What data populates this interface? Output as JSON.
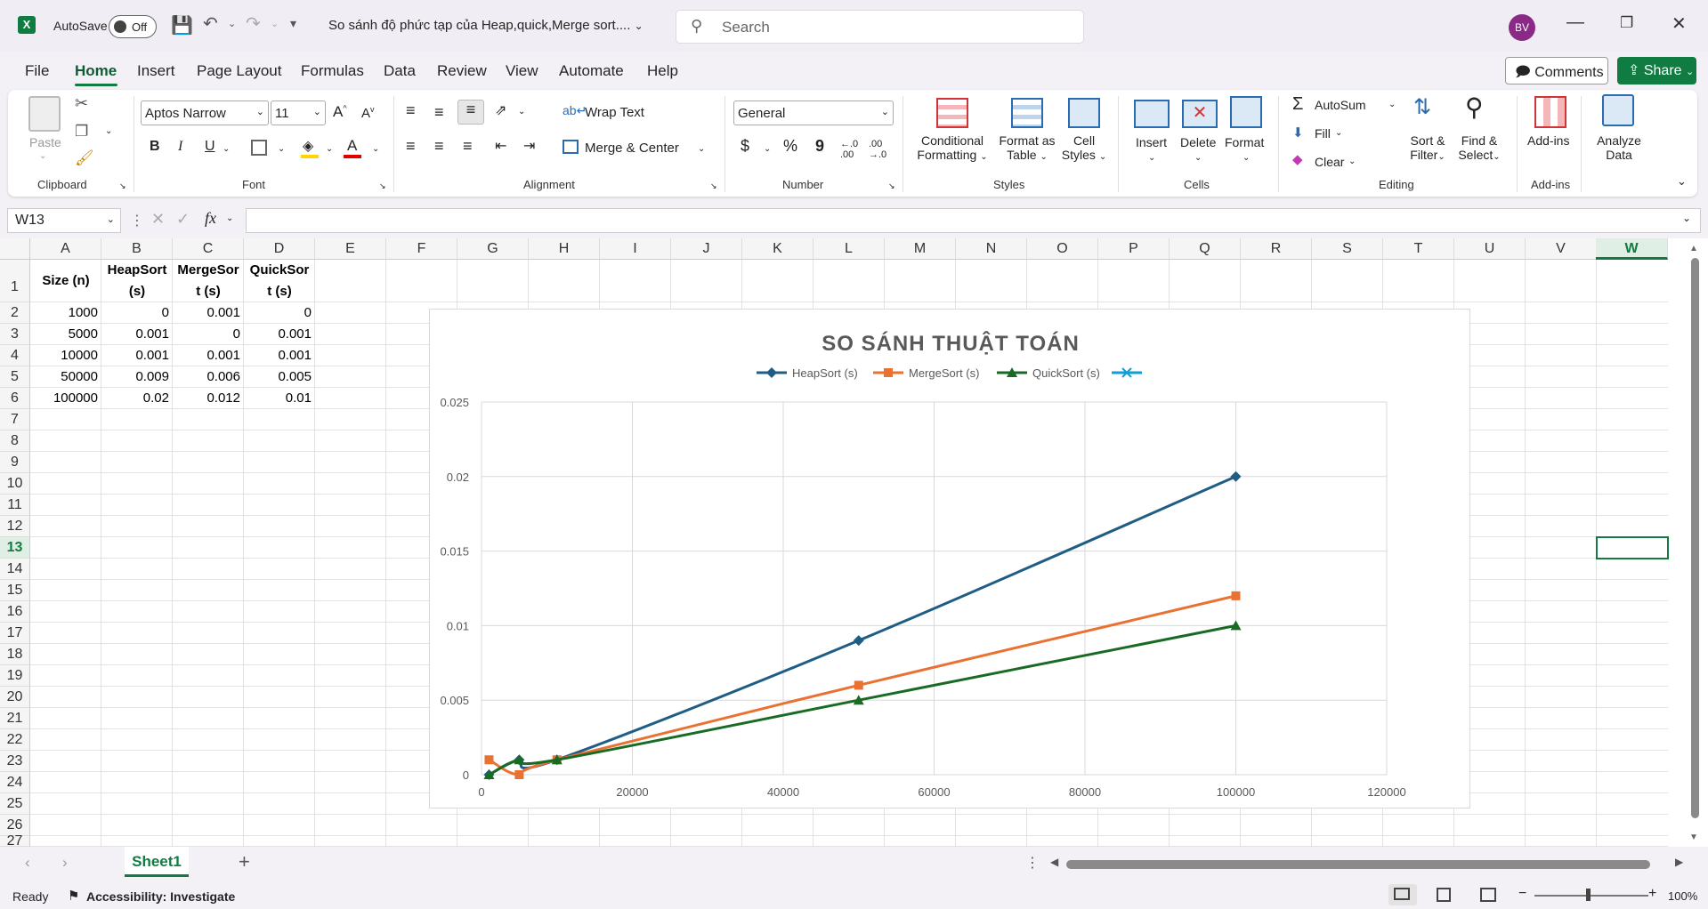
{
  "titlebar": {
    "autosave_label": "AutoSave",
    "autosave_state": "Off",
    "document_title": "So sánh độ phức tạp của Heap,quick,Merge sort....",
    "search_placeholder": "Search",
    "avatar_initials": "BV"
  },
  "menu": {
    "tabs": [
      "File",
      "Home",
      "Insert",
      "Page Layout",
      "Formulas",
      "Data",
      "Review",
      "View",
      "Automate",
      "Help"
    ],
    "active": "Home",
    "comments_label": "Comments",
    "share_label": "Share"
  },
  "ribbon": {
    "clipboard": {
      "paste": "Paste",
      "label": "Clipboard"
    },
    "font": {
      "name": "Aptos Narrow",
      "size": "11",
      "bold": "B",
      "italic": "I",
      "underline": "U",
      "label": "Font"
    },
    "alignment": {
      "wrap_text": "Wrap Text",
      "merge_center": "Merge & Center",
      "label": "Alignment"
    },
    "number": {
      "format": "General",
      "currency": "$",
      "percent": "%",
      "comma": "9",
      "label": "Number"
    },
    "styles": {
      "conditional": "Conditional",
      "formatting": "Formatting",
      "format_as": "Format as",
      "table": "Table",
      "cell": "Cell",
      "cell_styles": "Styles",
      "label": "Styles"
    },
    "cells": {
      "insert": "Insert",
      "delete": "Delete",
      "format": "Format",
      "label": "Cells"
    },
    "editing": {
      "autosum": "AutoSum",
      "fill": "Fill",
      "clear": "Clear",
      "sort": "Sort &",
      "filter": "Filter",
      "find": "Find &",
      "select": "Select",
      "label": "Editing"
    },
    "addins": {
      "addins": "Add-ins",
      "label": "Add-ins"
    },
    "analyze": {
      "line1": "Analyze",
      "line2": "Data"
    }
  },
  "formula_bar": {
    "name_box": "W13",
    "fx": "fx",
    "value": ""
  },
  "grid": {
    "columns": [
      "A",
      "B",
      "C",
      "D",
      "E",
      "F",
      "G",
      "H",
      "I",
      "J",
      "K",
      "L",
      "M",
      "N",
      "O",
      "P",
      "Q",
      "R",
      "S",
      "T",
      "U",
      "V",
      "W"
    ],
    "rows": [
      "1",
      "2",
      "3",
      "4",
      "5",
      "6",
      "7",
      "8",
      "9",
      "10",
      "11",
      "12",
      "13",
      "14",
      "15",
      "16",
      "17",
      "18",
      "19",
      "20",
      "21",
      "22",
      "23",
      "24",
      "25",
      "26",
      "27"
    ],
    "selected_cell": "W13",
    "header": {
      "a": "Size (n)",
      "b1": "HeapSort",
      "b2": "(s)",
      "c1": "MergeSor",
      "c2": "t (s)",
      "d1": "QuickSor",
      "d2": "t (s)"
    },
    "data": [
      [
        "1000",
        "0",
        "0.001",
        "0"
      ],
      [
        "5000",
        "0.001",
        "0",
        "0.001"
      ],
      [
        "10000",
        "0.001",
        "0.001",
        "0.001"
      ],
      [
        "50000",
        "0.009",
        "0.006",
        "0.005"
      ],
      [
        "100000",
        "0.02",
        "0.012",
        "0.01"
      ]
    ]
  },
  "chart_data": {
    "type": "scatter",
    "title": "SO SÁNH THUẬT TOÁN",
    "legend_position": "top",
    "x": [
      1000,
      5000,
      10000,
      50000,
      100000
    ],
    "series": [
      {
        "name": "HeapSort (s)",
        "values": [
          0,
          0.001,
          0.001,
          0.009,
          0.02
        ],
        "color": "#1f5d84",
        "marker": "diamond"
      },
      {
        "name": "MergeSort (s)",
        "values": [
          0.001,
          0,
          0.001,
          0.006,
          0.012
        ],
        "color": "#e97132",
        "marker": "square"
      },
      {
        "name": "QuickSort (s)",
        "values": [
          0,
          0.001,
          0.001,
          0.005,
          0.01
        ],
        "color": "#196b24",
        "marker": "triangle"
      },
      {
        "name": "",
        "values": [],
        "color": "#0f9ed5",
        "marker": "x"
      }
    ],
    "xlim": [
      0,
      120000
    ],
    "ylim": [
      0,
      0.025
    ],
    "xticks": [
      "0",
      "20000",
      "40000",
      "60000",
      "80000",
      "100000",
      "120000"
    ],
    "yticks": [
      "0",
      "0.005",
      "0.01",
      "0.015",
      "0.02",
      "0.025"
    ],
    "grid": true
  },
  "sheets": {
    "tabs": [
      "Sheet1"
    ],
    "active": "Sheet1",
    "add": "+"
  },
  "status": {
    "ready": "Ready",
    "accessibility": "Accessibility: Investigate",
    "zoom": "100%"
  }
}
